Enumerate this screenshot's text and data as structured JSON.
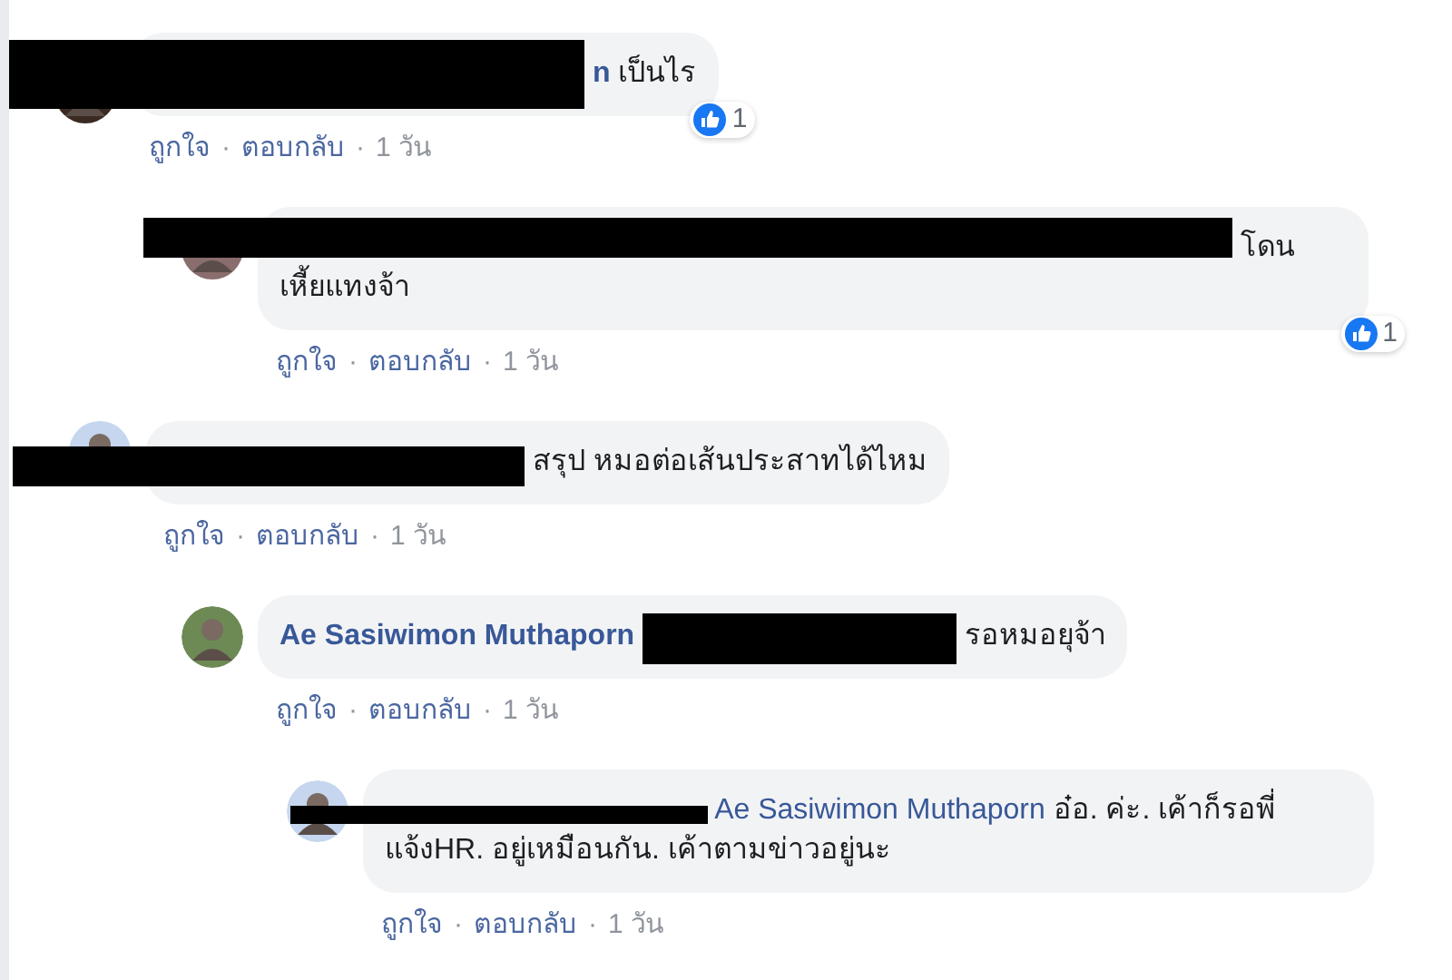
{
  "comments": [
    {
      "redacted": true,
      "author": "n",
      "text": "เป็นไร",
      "reaction_count": "1",
      "like": "ถูกใจ",
      "dot_1": "·",
      "reply": "ตอบกลับ",
      "dot_2": "·",
      "time": "1 วัน",
      "children": [
        {
          "redacted": true,
          "text": "โดน เหี้ยแทงจ้า",
          "reaction_count": "1",
          "like": "ถูกใจ",
          "dot_1": "·",
          "reply": "ตอบกลับ",
          "dot_2": "·",
          "time": "1 วัน"
        }
      ]
    },
    {
      "redacted": true,
      "text": "สรุป หมอต่อเส้นประสาทได้ไหม",
      "like": "ถูกใจ",
      "dot_1": "·",
      "reply": "ตอบกลับ",
      "dot_2": "·",
      "time": "1 วัน",
      "children": [
        {
          "redacted": true,
          "author": "Ae Sasiwimon Muthaporn",
          "text": "รอหมอยุจ้า",
          "like": "ถูกใจ",
          "dot_1": "·",
          "reply": "ตอบกลับ",
          "dot_2": "·",
          "time": "1 วัน",
          "children": [
            {
              "redacted": true,
              "mention": "Ae Sasiwimon Muthaporn",
              "text": "อ๋อ. ค่ะ. เค้าก็รอพี่แจ้งHR. อยู่เหมือนกัน. เค้าตามข่าวอยู่นะ",
              "like": "ถูกใจ",
              "dot_1": "·",
              "reply": "ตอบกลับ",
              "dot_2": "·",
              "time": "1 วัน"
            }
          ]
        }
      ]
    }
  ]
}
